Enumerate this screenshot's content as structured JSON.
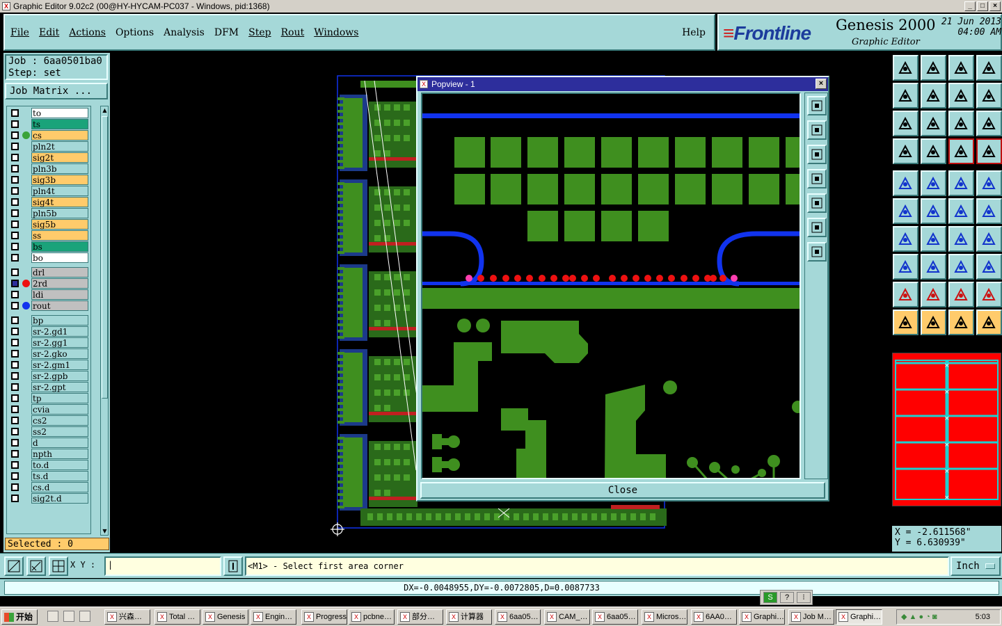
{
  "window": {
    "title": "Graphic Editor 9.02c2 (00@HY-HYCAM-PC037 - Windows, pid:1368)"
  },
  "menu": [
    "File",
    "Edit",
    "Actions",
    "Options",
    "Analysis",
    "DFM",
    "Step",
    "Rout",
    "Windows"
  ],
  "menu_help": "Help",
  "brand": {
    "logo": "Frontline",
    "product": "Genesis 2000",
    "subtitle": "Graphic Editor",
    "date": "21 Jun 2013",
    "time": "04:00 AM"
  },
  "job": {
    "job_line": "Job : 6aa0501ba0",
    "step_line": "Step: set",
    "job_matrix": "Job Matrix ..."
  },
  "layers": [
    {
      "name": "to",
      "color": "#ffffff",
      "dot": ""
    },
    {
      "name": "ts",
      "color": "#1aa37a",
      "dot": ""
    },
    {
      "name": "cs",
      "color": "#ffcb6b",
      "dot": "#3aa33a"
    },
    {
      "name": "pln2t",
      "color": "#a5d8d8",
      "dot": ""
    },
    {
      "name": "sig2t",
      "color": "#ffcb6b",
      "dot": ""
    },
    {
      "name": "pln3b",
      "color": "#a5d8d8",
      "dot": ""
    },
    {
      "name": "sig3b",
      "color": "#ffcb6b",
      "dot": ""
    },
    {
      "name": "pln4t",
      "color": "#a5d8d8",
      "dot": ""
    },
    {
      "name": "sig4t",
      "color": "#ffcb6b",
      "dot": ""
    },
    {
      "name": "pln5b",
      "color": "#a5d8d8",
      "dot": ""
    },
    {
      "name": "sig5b",
      "color": "#ffcb6b",
      "dot": ""
    },
    {
      "name": "ss",
      "color": "#ffcb6b",
      "dot": ""
    },
    {
      "name": "bs",
      "color": "#1aa37a",
      "dot": ""
    },
    {
      "name": "bo",
      "color": "#ffffff",
      "dot": ""
    },
    {
      "name": "drl",
      "color": "#c0c0c0",
      "dot": ""
    },
    {
      "name": "2rd",
      "color": "#c0c0c0",
      "dot": "#ee1111"
    },
    {
      "name": "ldi",
      "color": "#c0c0c0",
      "dot": ""
    },
    {
      "name": "rout",
      "color": "#c0c0c0",
      "dot": "#1133ee"
    },
    {
      "name": "bp",
      "color": "#a5d8d8",
      "dot": ""
    },
    {
      "name": "sr-2.gd1",
      "color": "#a5d8d8",
      "dot": ""
    },
    {
      "name": "sr-2.gg1",
      "color": "#a5d8d8",
      "dot": ""
    },
    {
      "name": "sr-2.gko",
      "color": "#a5d8d8",
      "dot": ""
    },
    {
      "name": "sr-2.gm1",
      "color": "#a5d8d8",
      "dot": ""
    },
    {
      "name": "sr-2.gpb",
      "color": "#a5d8d8",
      "dot": ""
    },
    {
      "name": "sr-2.gpt",
      "color": "#a5d8d8",
      "dot": ""
    },
    {
      "name": "tp",
      "color": "#a5d8d8",
      "dot": ""
    },
    {
      "name": "cvia",
      "color": "#a5d8d8",
      "dot": ""
    },
    {
      "name": "cs2",
      "color": "#a5d8d8",
      "dot": ""
    },
    {
      "name": "ss2",
      "color": "#a5d8d8",
      "dot": ""
    },
    {
      "name": "d",
      "color": "#a5d8d8",
      "dot": ""
    },
    {
      "name": "npth",
      "color": "#a5d8d8",
      "dot": ""
    },
    {
      "name": "to.d",
      "color": "#a5d8d8",
      "dot": ""
    },
    {
      "name": "ts.d",
      "color": "#a5d8d8",
      "dot": ""
    },
    {
      "name": "cs.d",
      "color": "#a5d8d8",
      "dot": ""
    },
    {
      "name": "sig2t.d",
      "color": "#a5d8d8",
      "dot": ""
    }
  ],
  "selected_text": "Selected : 0",
  "popview": {
    "title": "Popview - 1",
    "close_label": "Close"
  },
  "coords": {
    "x": "X = -2.611568\"",
    "y": "Y = 6.630939\""
  },
  "bottom": {
    "xy_label": "X Y :",
    "prompt": "<M1> - Select first area corner",
    "unit": "Inch"
  },
  "status": "DX=-0.0048955,DY=-0.0072805,D=0.0087733",
  "taskbar": {
    "start": "开始",
    "tasks": [
      "兴森…",
      "Total …",
      "Genesis",
      "Engin…",
      "Progress",
      "pcbne…",
      "部分…",
      "计算器",
      "6aa05…",
      "CAM_…",
      "6aa05…",
      "Micros…",
      "6AA0…",
      "Graphi…",
      "Job M…",
      "Graphi…"
    ],
    "clock": "5:03"
  },
  "colors": {
    "panel": "#a5d8d8",
    "copper": "#3f8f1f",
    "rout": "#1133ee",
    "drill": "#ee1111"
  }
}
